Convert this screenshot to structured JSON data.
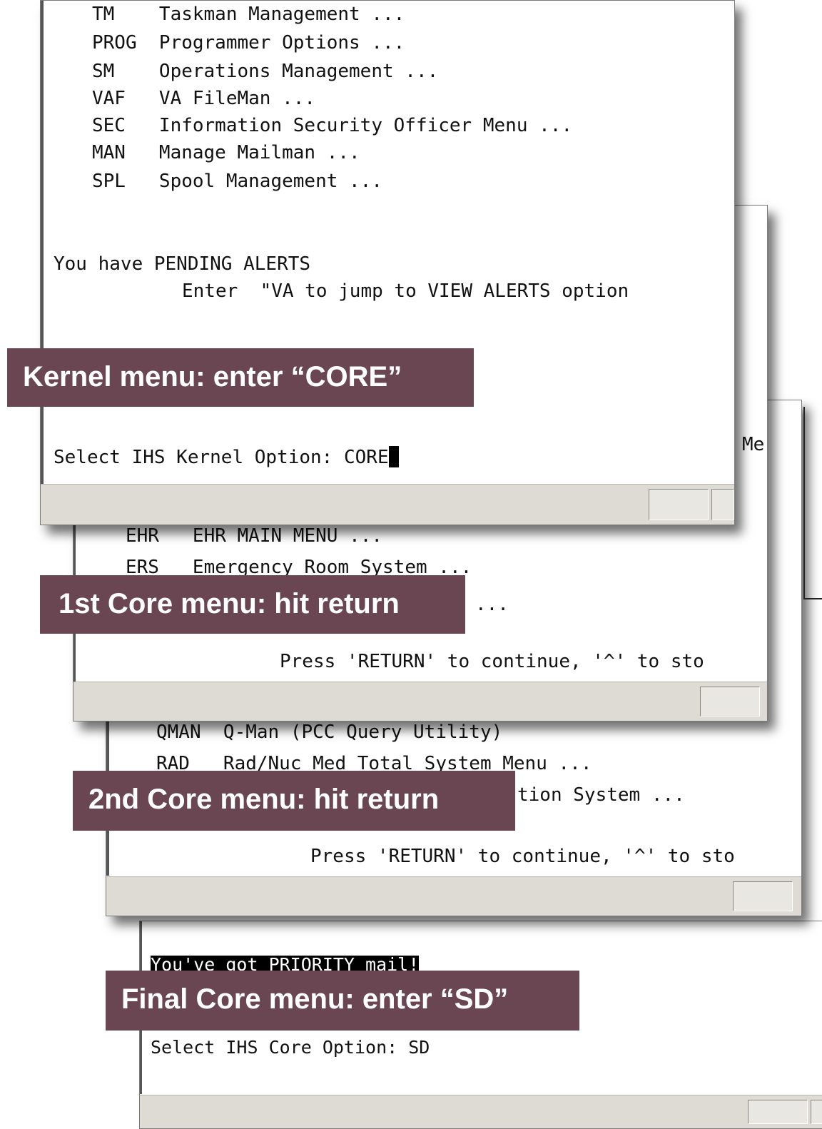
{
  "win1": {
    "lines": [
      "TM    Taskman Management ...",
      "PROG  Programmer Options ...",
      "SM    Operations Management ...",
      "VAF   VA FileMan ...",
      "SEC   Information Security Officer Menu ...",
      "MAN   Manage Mailman ...",
      "SPL   Spool Management ..."
    ],
    "alert_line1": "You have PENDING ALERTS",
    "alert_line2": "Enter  \"VA to jump to VIEW ALERTS option",
    "prompt": "Select IHS Kernel Option: CORE"
  },
  "win2": {
    "peek_text": "Me",
    "lines": [
      "EHR   EHR MAIN MENU ...",
      "ERS   Emergency Room System ..."
    ],
    "partial": "...",
    "press": "Press 'RETURN' to continue, '^' to sto"
  },
  "win3": {
    "lines": [
      "QMAN  Q-Man (PCC Query Utility)",
      "RAD   Rad/Nuc Med Total System Menu ..."
    ],
    "partial": "tion System ...",
    "press": "Press 'RETURN' to continue, '^' to sto"
  },
  "win4": {
    "priority": "You've got PRIORITY mail!",
    "prompt": "Select IHS Core Option: SD"
  },
  "callouts": {
    "kernel": "Kernel menu: enter “CORE”",
    "core1": "1st Core menu: hit return",
    "core2": "2nd Core menu: hit return",
    "final": "Final Core menu: enter “SD”"
  },
  "colors": {
    "callout_bg": "#6a4653",
    "statusbar": "#dedbd5"
  }
}
